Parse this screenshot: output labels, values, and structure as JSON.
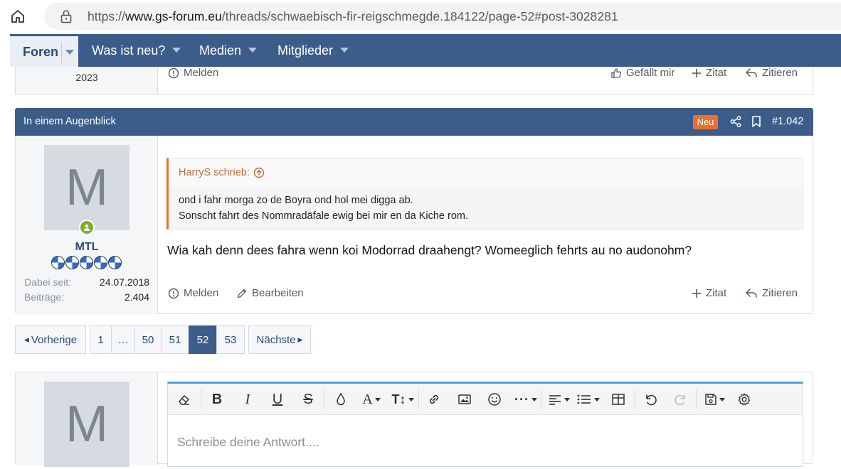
{
  "browser": {
    "url_prefix": "https://",
    "url_host": "www.gs-forum.eu",
    "url_path": "/threads/schwaebisch-fir-reigschmegde.184122/page-52#post-3028281"
  },
  "nav": {
    "items": [
      {
        "label": "Foren"
      },
      {
        "label": "Was ist neu?"
      },
      {
        "label": "Medien"
      },
      {
        "label": "Mitglieder"
      }
    ]
  },
  "prev_post": {
    "year": "2023",
    "actions": {
      "report": "Melden",
      "like": "Gefällt mir",
      "quote_add": "Zitat",
      "reply": "Zitieren"
    }
  },
  "post": {
    "header_title": "In einem Augenblick",
    "badge": "Neu",
    "number": "#1.042",
    "user": {
      "avatar_letter": "M",
      "name": "MTL",
      "joined_label": "Dabei seit:",
      "joined_value": "24.07.2018",
      "posts_label": "Beiträge:",
      "posts_value": "2.404"
    },
    "quote": {
      "author": "HarryS schrieb:",
      "lines": [
        "ond i fahr morga zo de Boyra ond hol mei digga ab.",
        "Sonscht fahrt des Nommradäfale ewig bei mir en da Kiche rom."
      ]
    },
    "text": "Wia kah denn dees fahra wenn koi Modorrad draahengt? Womeeglich fehrts au no audonohm?",
    "actions": {
      "report": "Melden",
      "edit": "Bearbeiten",
      "quote_add": "Zitat",
      "reply": "Zitieren"
    }
  },
  "pagination": {
    "prev": "Vorherige",
    "next": "Nächste",
    "pages": [
      "1",
      "…",
      "50",
      "51",
      "52",
      "53"
    ],
    "current": "52"
  },
  "reply": {
    "avatar_letter": "M",
    "placeholder": "Schreibe deine Antwort...."
  },
  "colors": {
    "nav_bg": "#3c5d89",
    "badge_new": "#e9702f",
    "online": "#7ab02a",
    "editor_accent": "#4aa3df"
  }
}
